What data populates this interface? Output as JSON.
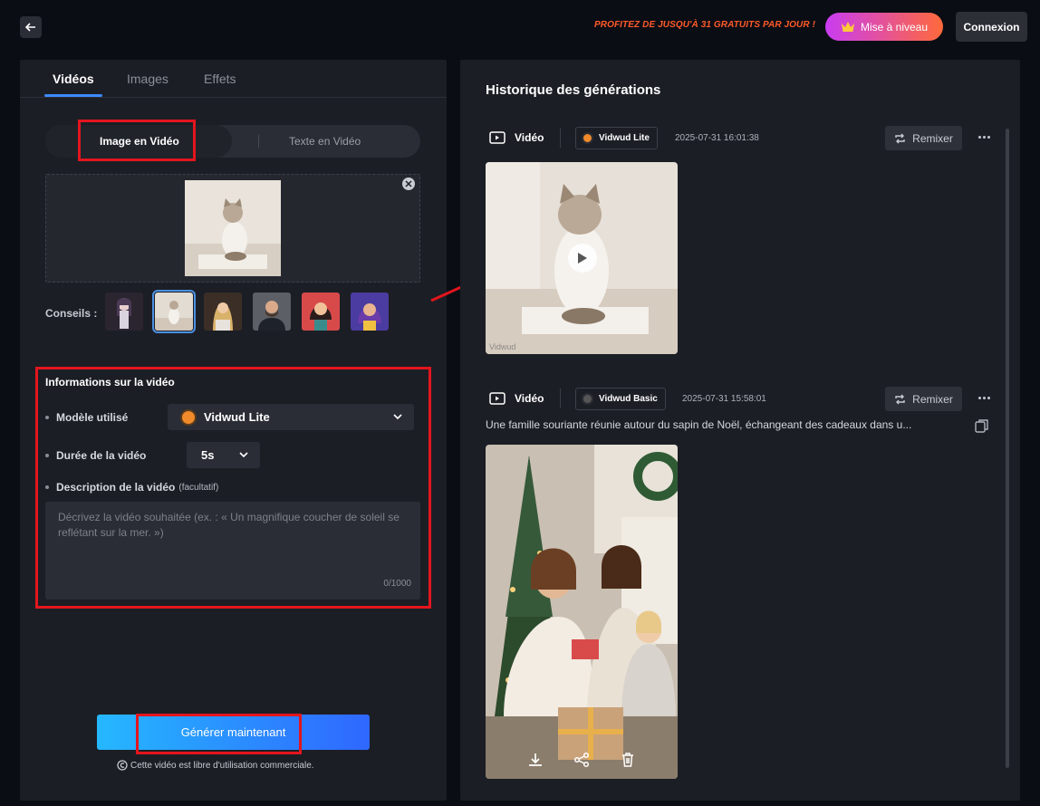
{
  "header": {
    "promo_text": "PROFITEZ DE JUSQU'À 31 GRATUITS PAR JOUR !",
    "upgrade_label": "Mise à niveau",
    "login_label": "Connexion"
  },
  "left_panel": {
    "tabs": [
      {
        "label": "Vidéos",
        "active": true
      },
      {
        "label": "Images",
        "active": false
      },
      {
        "label": "Effets",
        "active": false
      }
    ],
    "mode": {
      "image_to_video": "Image en Vidéo",
      "text_to_video": "Texte en Vidéo",
      "selected": "Image en Vidéo"
    },
    "tips_label": "Conseils :",
    "info_title": "Informations sur la vidéo",
    "model_label": "Modèle utilisé",
    "model_value": "Vidwud Lite",
    "duration_label": "Durée de la vidéo",
    "duration_value": "5s",
    "description_label": "Description de la vidéo",
    "description_optional": "(facultatif)",
    "description_placeholder": "Décrivez la vidéo souhaitée (ex. : « Un magnifique coucher de soleil se reflétant sur la mer. »)",
    "description_counter": "0/1000",
    "generate_label": "Générer maintenant",
    "commercial_note": "Cette vidéo est libre d'utilisation commerciale."
  },
  "history": {
    "title": "Historique des générations",
    "items": [
      {
        "type_label": "Vidéo",
        "model": "Vidwud Lite",
        "timestamp": "2025-07-31 16:01:38",
        "remix_label": "Remixer",
        "watermark": "Vidwud"
      },
      {
        "type_label": "Vidéo",
        "model": "Vidwud Basic",
        "timestamp": "2025-07-31 15:58:01",
        "remix_label": "Remixer",
        "prompt": "Une famille souriante réunie autour du sapin de Noël, échangeant des cadeaux dans u..."
      }
    ]
  },
  "colors": {
    "accent_blue": "#3d8bfd",
    "highlight_red": "#e3151d",
    "promo_orange": "#ff5a2a"
  }
}
